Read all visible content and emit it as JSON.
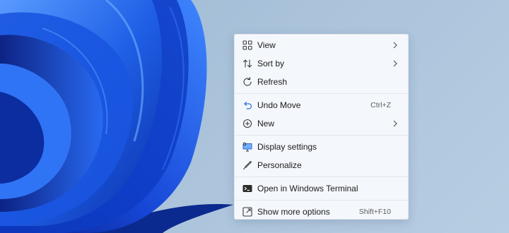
{
  "desktop": {
    "background_color": "#a9c2da",
    "wallpaper_colors": [
      "#0a2fa8",
      "#1f5fe6",
      "#4a90ff",
      "#0b1d7a"
    ]
  },
  "context_menu": {
    "groups": [
      [
        {
          "label": "View",
          "icon": "grid-view-icon",
          "has_submenu": true
        },
        {
          "label": "Sort by",
          "icon": "sort-arrows-icon",
          "has_submenu": true
        },
        {
          "label": "Refresh",
          "icon": "refresh-icon"
        }
      ],
      [
        {
          "label": "Undo Move",
          "icon": "undo-icon",
          "shortcut": "Ctrl+Z"
        },
        {
          "label": "New",
          "icon": "plus-circle-icon",
          "has_submenu": true
        }
      ],
      [
        {
          "label": "Display settings",
          "icon": "display-monitor-icon"
        },
        {
          "label": "Personalize",
          "icon": "pen-brush-icon"
        }
      ],
      [
        {
          "label": "Open in Windows Terminal",
          "icon": "terminal-icon"
        }
      ],
      [
        {
          "label": "Show more options",
          "icon": "more-options-icon",
          "shortcut": "Shift+F10"
        }
      ]
    ]
  }
}
